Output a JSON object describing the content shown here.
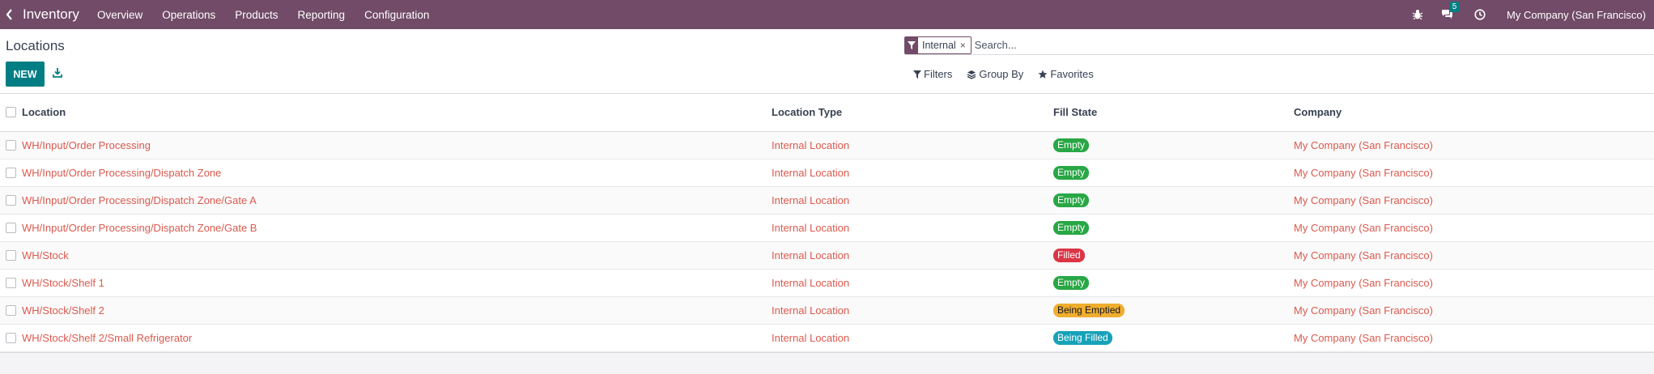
{
  "navbar": {
    "app_name": "Inventory",
    "menus": [
      "Overview",
      "Operations",
      "Products",
      "Reporting",
      "Configuration"
    ],
    "message_count": "5",
    "company": "My Company (San Francisco)",
    "icons": [
      "chevron-left-icon",
      "bug-icon",
      "chat-icon",
      "clock-icon"
    ]
  },
  "control": {
    "breadcrumb": "Locations",
    "new_label": "NEW",
    "search": {
      "facet_value": "Internal",
      "facet_close": "×",
      "placeholder": "Search..."
    },
    "filters_label": "Filters",
    "group_by_label": "Group By",
    "favorites_label": "Favorites"
  },
  "table": {
    "columns": [
      "Location",
      "Location Type",
      "Fill State",
      "Company"
    ],
    "rows": [
      {
        "location": "WH/Input/Order Processing",
        "type": "Internal Location",
        "state": "Empty",
        "company": "My Company (San Francisco)"
      },
      {
        "location": "WH/Input/Order Processing/Dispatch Zone",
        "type": "Internal Location",
        "state": "Empty",
        "company": "My Company (San Francisco)"
      },
      {
        "location": "WH/Input/Order Processing/Dispatch Zone/Gate A",
        "type": "Internal Location",
        "state": "Empty",
        "company": "My Company (San Francisco)"
      },
      {
        "location": "WH/Input/Order Processing/Dispatch Zone/Gate B",
        "type": "Internal Location",
        "state": "Empty",
        "company": "My Company (San Francisco)"
      },
      {
        "location": "WH/Stock",
        "type": "Internal Location",
        "state": "Filled",
        "company": "My Company (San Francisco)"
      },
      {
        "location": "WH/Stock/Shelf 1",
        "type": "Internal Location",
        "state": "Empty",
        "company": "My Company (San Francisco)"
      },
      {
        "location": "WH/Stock/Shelf 2",
        "type": "Internal Location",
        "state": "Being Emptied",
        "company": "My Company (San Francisco)"
      },
      {
        "location": "WH/Stock/Shelf 2/Small Refrigerator",
        "type": "Internal Location",
        "state": "Being Filled",
        "company": "My Company (San Francisco)"
      }
    ]
  },
  "colors": {
    "navbar": "#714b67",
    "primary": "#017e84",
    "link": "#da5a4f",
    "state_empty": "#28a745",
    "state_filled": "#dc3545",
    "state_being_emptied": "#f0ad2e",
    "state_being_filled": "#17a2b8"
  }
}
